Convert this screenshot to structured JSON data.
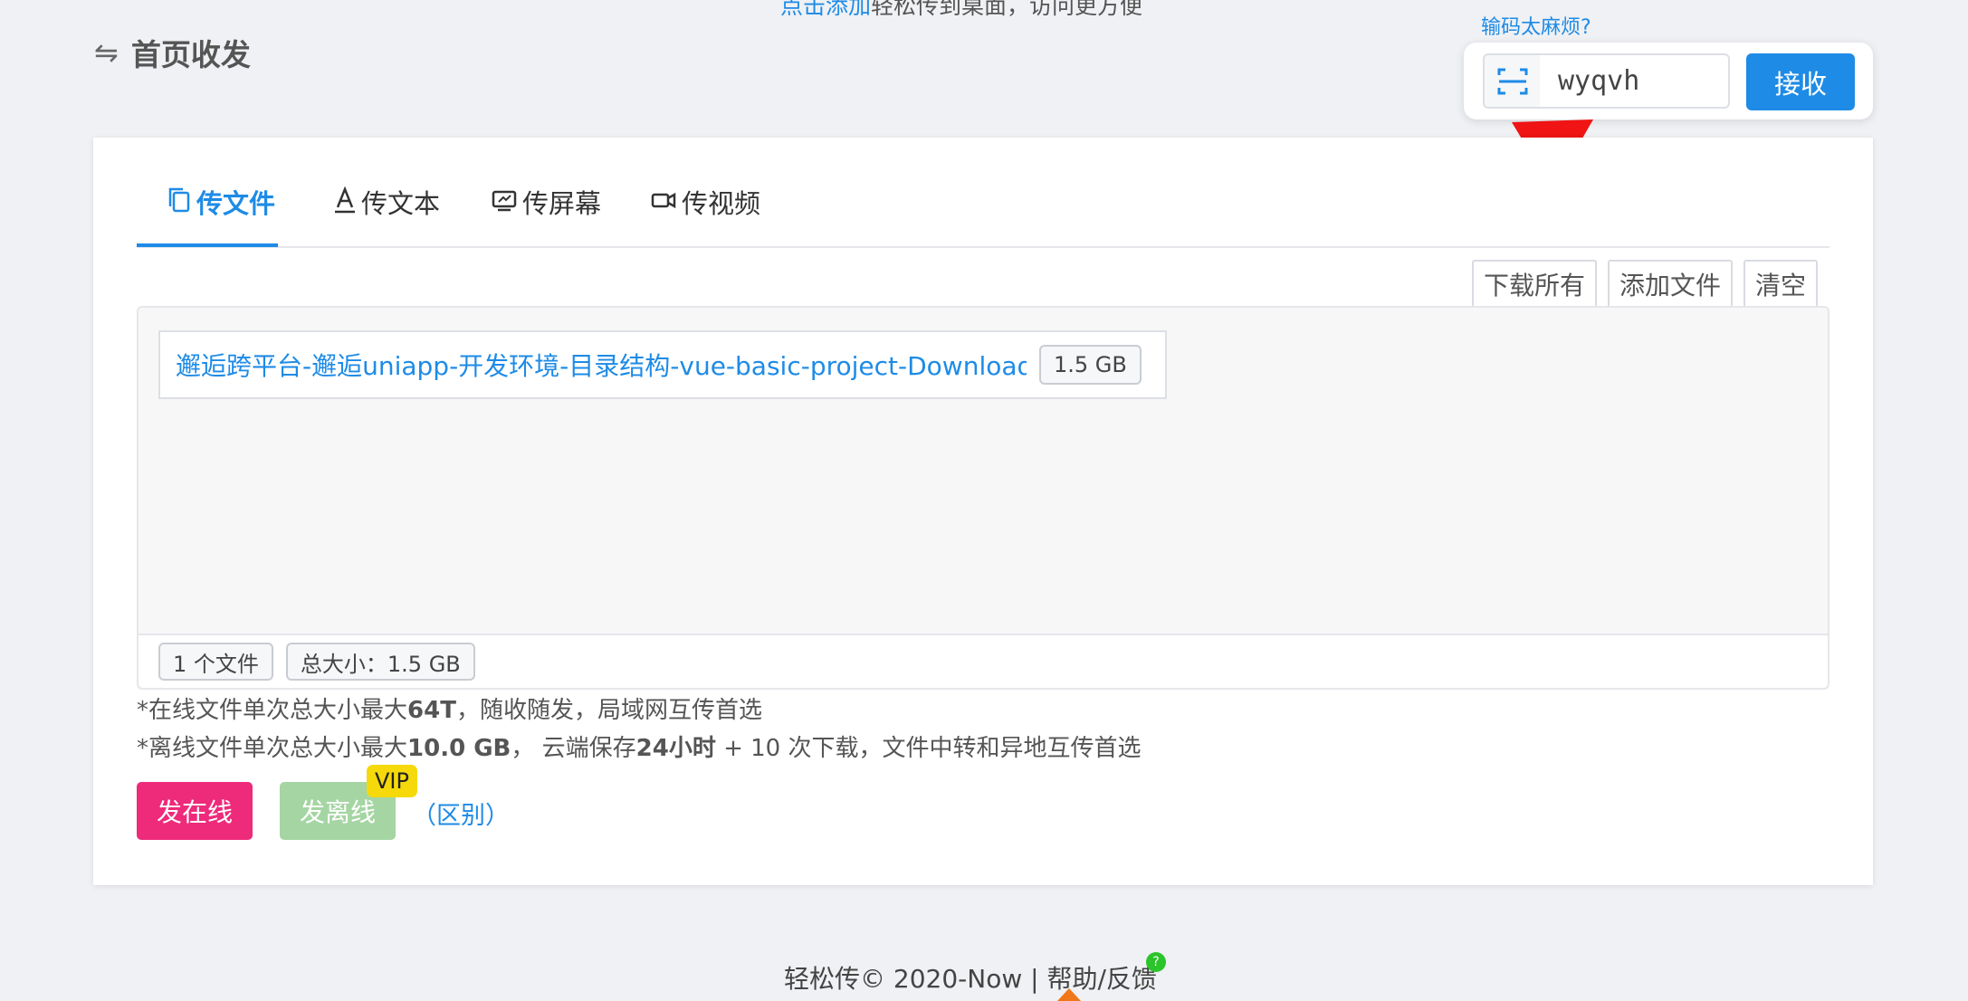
{
  "top_banner": {
    "link": "点击添加",
    "text": "轻松传到桌面，访问更方便"
  },
  "header": {
    "swap_icon": "swap-arrows-icon",
    "title": "首页收发"
  },
  "receive": {
    "hint": "输码太麻烦?",
    "scan_icon": "scan-icon",
    "code_value": "wyqvh",
    "button_label": "接收"
  },
  "tabs": [
    {
      "label": "传文件",
      "icon": "file-copy-icon",
      "active": true
    },
    {
      "label": "传文本",
      "icon": "text-icon",
      "active": false
    },
    {
      "label": "传屏幕",
      "icon": "screen-share-icon",
      "active": false
    },
    {
      "label": "传视频",
      "icon": "video-camera-icon",
      "active": false
    }
  ],
  "toolbar": {
    "download_all": "下载所有",
    "add_file": "添加文件",
    "clear": "清空"
  },
  "files": [
    {
      "name": "邂逅跨平台-邂逅uniapp-开发环境-目录结构-vue-basic-project-Downloading",
      "size": "1.5 GB"
    }
  ],
  "summary": {
    "count": "1 个文件",
    "total": "总大小：1.5 GB"
  },
  "notes": {
    "online_prefix": "*在线文件单次总大小最大",
    "online_limit": "64T",
    "online_suffix": "，随收随发，局域网互传首选",
    "offline_prefix": "*离线文件单次总大小最大",
    "offline_limit": "10.0 GB",
    "offline_mid1": "， 云端保存",
    "offline_time": "24小时",
    "offline_suffix": " + 10 次下载，文件中转和异地互传首选"
  },
  "actions": {
    "send_online": "发在线",
    "send_offline": "发离线",
    "vip": "VIP",
    "diff": "（区别）"
  },
  "footer": {
    "text": "轻松传© 2020-Now | 帮助/反馈",
    "help_badge": "?"
  },
  "colors": {
    "accent": "#1e8be6",
    "online_button": "#ee2a7b",
    "offline_button": "#a5d5a3",
    "vip": "#f5d90a",
    "annotation_arrow": "#f01414"
  }
}
